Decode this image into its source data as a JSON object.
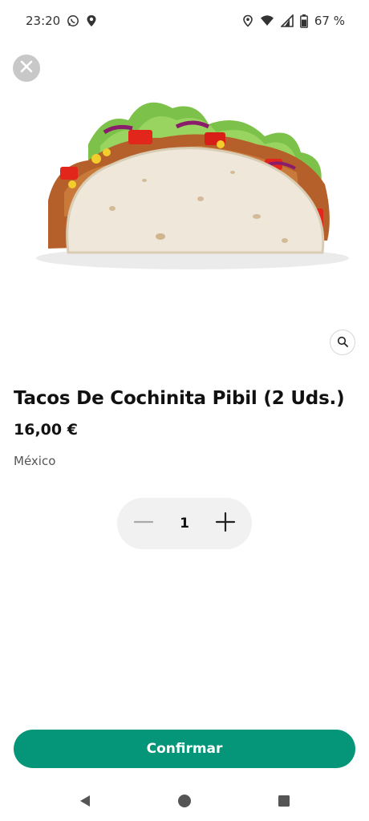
{
  "status_bar": {
    "time": "23:20",
    "battery": "67 %",
    "icons": [
      "whatsapp-icon",
      "location-pin-icon",
      "location-icon",
      "wifi-icon",
      "signal-icon",
      "battery-icon"
    ]
  },
  "product": {
    "title": "Tacos De Cochinita Pibil (2 Uds.)",
    "price": "16,00 €",
    "origin": "México",
    "image": "taco-image"
  },
  "stepper": {
    "quantity": "1",
    "decrement_icon": "minus-icon",
    "increment_icon": "plus-icon"
  },
  "actions": {
    "confirm_label": "Confirmar",
    "close_icon": "close-icon",
    "zoom_icon": "magnifier-icon"
  },
  "colors": {
    "accent": "#05967a",
    "close_bg": "#c8c8c8",
    "stepper_bg": "#f1f1f1"
  },
  "nav_bar": {
    "icons": [
      "back-icon",
      "home-icon",
      "recents-icon"
    ]
  }
}
